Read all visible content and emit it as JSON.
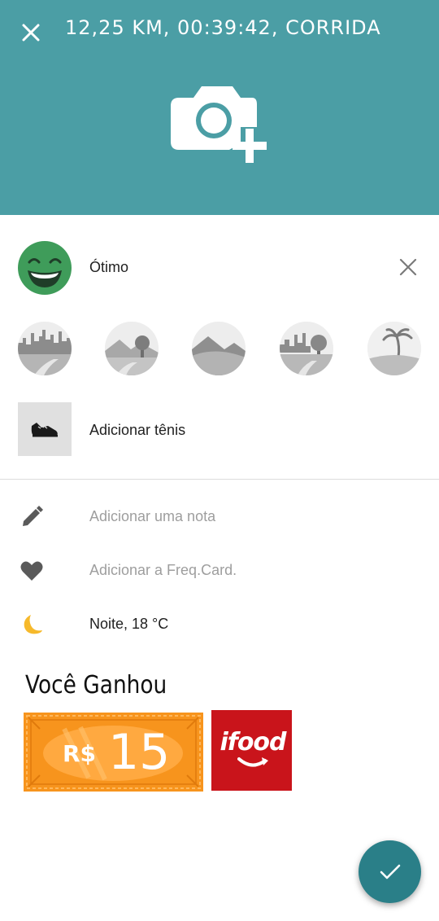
{
  "header": {
    "title": "12,25 KM, 00:39:42, CORRIDA",
    "background_color": "#4b9ea5",
    "close_icon": "close-icon",
    "add_photo_icon": "add-photo-icon"
  },
  "mood": {
    "label": "Ótimo",
    "face_color": "#3f9c5a",
    "icon": "smiling-face-icon"
  },
  "terrains": [
    {
      "name": "city"
    },
    {
      "name": "trail"
    },
    {
      "name": "hills"
    },
    {
      "name": "park"
    },
    {
      "name": "beach"
    }
  ],
  "shoe": {
    "label": "Adicionar tênis",
    "icon": "shoe-icon"
  },
  "details": {
    "note": "Adicionar uma nota",
    "heart_rate": "Adicionar a Freq.Card.",
    "weather": "Noite, 18 °C"
  },
  "reward": {
    "title": "Você Ganhou",
    "currency": "R$",
    "amount": "15",
    "voucher_color": "#f7941d",
    "brand": "ifood",
    "brand_color": "#c9141b"
  },
  "fab": {
    "icon": "check-icon",
    "color": "#2a7f88"
  }
}
